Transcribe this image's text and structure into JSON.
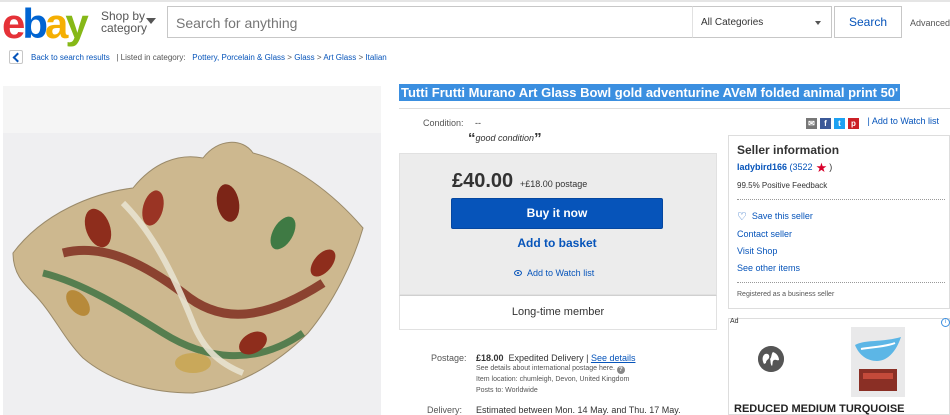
{
  "header": {
    "logo_letters": [
      "e",
      "b",
      "a",
      "y"
    ],
    "logo_colors": [
      "#e53238",
      "#0064d2",
      "#f5af02",
      "#86b817"
    ],
    "shop_by_line1": "Shop by",
    "shop_by_line2": "category",
    "search_placeholder": "Search for anything",
    "category_select": "All Categories",
    "search_button": "Search",
    "advanced_link": "Advanced"
  },
  "breadcrumb": {
    "back_label": "Back to search results",
    "listed_in": "| Listed in category:",
    "items": [
      "Pottery, Porcelain & Glass",
      "Glass",
      "Art Glass",
      "Italian"
    ],
    "separator": ">"
  },
  "listing": {
    "title": "Tutti Frutti Murano Art Glass Bowl gold adventurine AVeM folded animal print 50'",
    "condition_label": "Condition:",
    "condition_value": "--",
    "condition_note": "good condition",
    "open_quote": "“",
    "close_quote": "”",
    "price": "£40.00",
    "postage_small": "+£18.00 postage",
    "buy_now": "Buy it now",
    "add_to_basket": "Add to basket",
    "add_to_watch": "Add to Watch list",
    "member_status": "Long-time member",
    "postage_label": "Postage:",
    "postage_price": "£18.00",
    "postage_method": "Expedited Delivery |",
    "see_details": "See details",
    "postage_intl": "See details about international postage here.",
    "item_location": "Item location:  chumleigh, Devon, United Kingdom",
    "posts_to": "Posts to:  Worldwide",
    "delivery_label": "Delivery:",
    "delivery_value": "Estimated between Mon. 14 May. and Thu. 17 May."
  },
  "share": {
    "add_to_watch": "| Add to Watch list",
    "icons": [
      "email-icon",
      "facebook-icon",
      "twitter-icon",
      "pinterest-icon"
    ]
  },
  "seller": {
    "heading": "Seller information",
    "name": "ladybird166",
    "count_open": "(3522",
    "count_close": ")",
    "feedback": "99.5% Positive Feedback",
    "save_seller": "Save this seller",
    "contact": "Contact seller",
    "visit_shop": "Visit Shop",
    "see_other": "See other items",
    "registered": "Registered as a business seller"
  },
  "ad": {
    "label": "Ad",
    "info": "i",
    "title": "REDUCED MEDIUM TURQUOISE"
  },
  "colors": {
    "link": "#0654ba",
    "title_highlight": "#3b8fe0",
    "star": "#d9002b"
  }
}
